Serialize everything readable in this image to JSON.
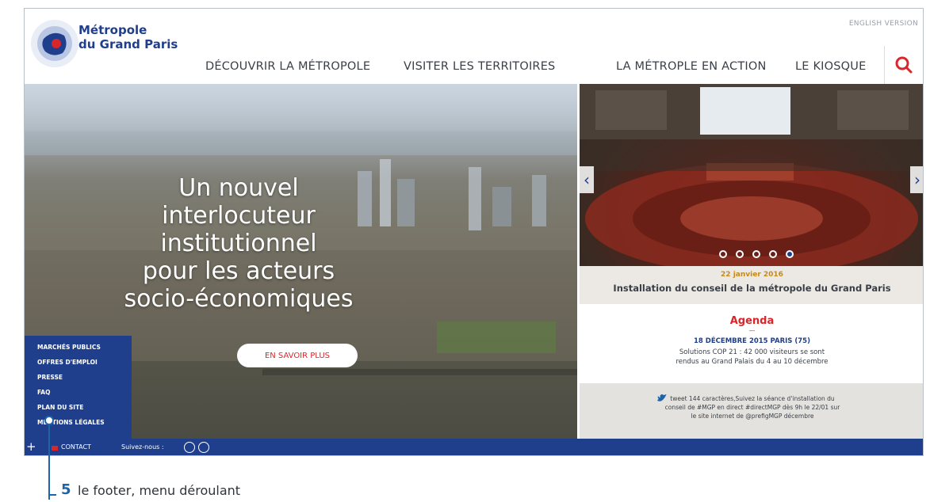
{
  "header": {
    "logo_line1": "Métropole",
    "logo_line2": "du Grand Paris",
    "english_link": "ENGLISH VERSION",
    "nav": [
      {
        "label": "DÉCOUVRIR LA MÉTROPOLE"
      },
      {
        "label": "VISITER LES TERRITOIRES"
      },
      {
        "label": "LA MÉTROPLE EN ACTION"
      },
      {
        "label": "LE KIOSQUE"
      }
    ],
    "search_icon": "search-icon"
  },
  "hero": {
    "title_lines": [
      "Un nouvel interlocuteur",
      "institutionnel",
      "pour les acteurs",
      "socio-économiques"
    ],
    "cta_label": "EN SAVOIR PLUS"
  },
  "side_menu": {
    "items": [
      "MARCHÉS PUBLICS",
      "OFFRES D'EMPLOI",
      "PRESSE",
      "FAQ",
      "PLAN DU SITE",
      "MENTIONS LÉGALES"
    ]
  },
  "slider": {
    "date": "22 janvier 2016",
    "caption": "Installation du conseil de la métropole du Grand Paris",
    "dot_count": 5,
    "active_dot": 5
  },
  "agenda": {
    "title": "Agenda",
    "dash": "—",
    "date": "18 DÉCEMBRE 2015 PARIS (75)",
    "text_line1": "Solutions COP 21 : 42 000 visiteurs se sont",
    "text_line2": "rendus au Grand Palais du 4 au 10 décembre"
  },
  "tweet": {
    "line1": "tweet 144 caractères,Suivez la séance d'installation du",
    "line2": "conseil de #MGP en direct  #directMGP dès 9h le 22/01 sur",
    "line3": "le site internet de @prefigMGP décembre"
  },
  "footer": {
    "plus": "+",
    "contact": "CONTACT",
    "follow": "Suivez-nous :"
  },
  "annotation": {
    "number": "5",
    "text": "le footer, menu déroulant"
  },
  "colors": {
    "brand_blue": "#1f3f8c",
    "accent_red": "#d9262b",
    "callout_blue": "#1f63a8"
  }
}
